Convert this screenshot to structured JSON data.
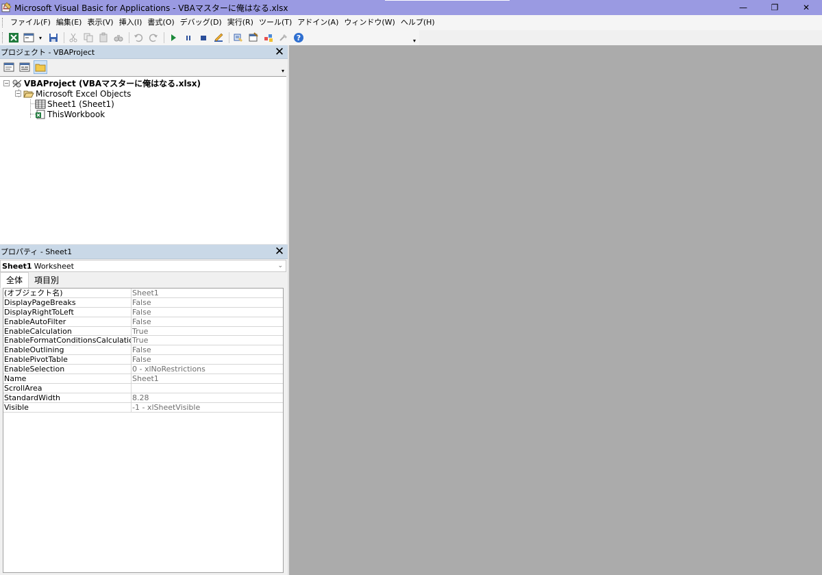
{
  "window": {
    "title": "Microsoft Visual Basic for Applications - VBAマスターに俺はなる.xlsx",
    "minimize_glyph": "—",
    "restore_glyph": "❐",
    "close_glyph": "✕"
  },
  "menu": {
    "items": [
      "ファイル(F)",
      "編集(E)",
      "表示(V)",
      "挿入(I)",
      "書式(O)",
      "デバッグ(D)",
      "実行(R)",
      "ツール(T)",
      "アドイン(A)",
      "ウィンドウ(W)",
      "ヘルプ(H)"
    ]
  },
  "toolbar": {
    "dropdown_glyph": "▾",
    "overflow_glyph": "▾"
  },
  "project_pane": {
    "title": "プロジェクト - VBAProject",
    "close_glyph": "✕",
    "scroll_glyph": "▾",
    "tree": {
      "project": "VBAProject (VBAマスターに俺はなる.xlsx)",
      "folder": "Microsoft Excel Objects",
      "sheet": "Sheet1 (Sheet1)",
      "workbook": "ThisWorkbook",
      "collapse_glyph": "−"
    }
  },
  "properties_pane": {
    "title": "プロパティ - Sheet1",
    "close_glyph": "✕",
    "object_name": "Sheet1",
    "object_type": "Worksheet",
    "dropdown_glyph": "⌄",
    "tabs": [
      "全体",
      "項目別"
    ],
    "rows": [
      {
        "name": "(オブジェクト名)",
        "value": "Sheet1"
      },
      {
        "name": "DisplayPageBreaks",
        "value": "False"
      },
      {
        "name": "DisplayRightToLeft",
        "value": "False"
      },
      {
        "name": "EnableAutoFilter",
        "value": "False"
      },
      {
        "name": "EnableCalculation",
        "value": "True"
      },
      {
        "name": "EnableFormatConditionsCalculation",
        "value": "True"
      },
      {
        "name": "EnableOutlining",
        "value": "False"
      },
      {
        "name": "EnablePivotTable",
        "value": "False"
      },
      {
        "name": "EnableSelection",
        "value": "0 - xlNoRestrictions"
      },
      {
        "name": "Name",
        "value": "Sheet1"
      },
      {
        "name": "ScrollArea",
        "value": ""
      },
      {
        "name": "StandardWidth",
        "value": "8.28"
      },
      {
        "name": "Visible",
        "value": "-1 - xlSheetVisible"
      }
    ]
  },
  "colors": {
    "titlebar": "#9a9ae2",
    "pane_header": "#c9d8e7",
    "workspace": "#ababab"
  }
}
